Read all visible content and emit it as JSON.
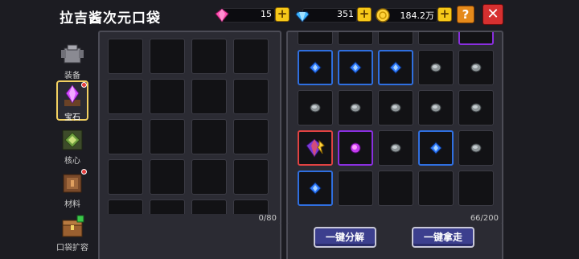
{
  "header": {
    "title": "拉吉酱次元口袋",
    "resources": [
      {
        "icon": "pink-gem-icon",
        "value": "15"
      },
      {
        "icon": "blue-diamond-icon",
        "value": "351"
      },
      {
        "icon": "gold-coin-icon",
        "value": "184.2万"
      }
    ],
    "plus_label": "+",
    "help_label": "?",
    "close_label": "✕"
  },
  "nav": {
    "items": [
      {
        "label": "装备",
        "icon": "armor-icon",
        "active": false,
        "badge": false
      },
      {
        "label": "宝石",
        "icon": "gem-crystal-icon",
        "active": true,
        "badge": true
      },
      {
        "label": "核心",
        "icon": "core-icon",
        "active": false,
        "badge": false
      },
      {
        "label": "材料",
        "icon": "material-box-icon",
        "active": false,
        "badge": true
      },
      {
        "label": "口袋扩容",
        "icon": "chest-expand-icon",
        "active": false,
        "badge": false
      }
    ]
  },
  "left_panel": {
    "capacity": "0/80"
  },
  "right_panel": {
    "capacity": "66/200",
    "rows": [
      [
        "blue-gem",
        "blue-gem",
        "blue-gem",
        "grey-gem",
        "grey-gem"
      ],
      [
        "grey-gem",
        "grey-gem",
        "grey-gem",
        "grey-gem",
        "grey-gem"
      ],
      [
        "special-gem",
        "purple-gem",
        "grey-gem",
        "blue-gem",
        "grey-gem"
      ],
      [
        "blue-gem",
        "empty",
        "empty",
        "empty",
        "empty"
      ]
    ]
  },
  "actions": {
    "decompose_label": "一键分解",
    "take_all_label": "一键拿走"
  },
  "colors": {
    "accent_gold": "#f6c819",
    "close_red": "#d63030",
    "help_orange": "#e58a1b",
    "rarity_blue": "#2f6fe0",
    "rarity_purple": "#8a2fe0",
    "rarity_red": "#e04242",
    "button_blue": "#3c3f8e"
  }
}
